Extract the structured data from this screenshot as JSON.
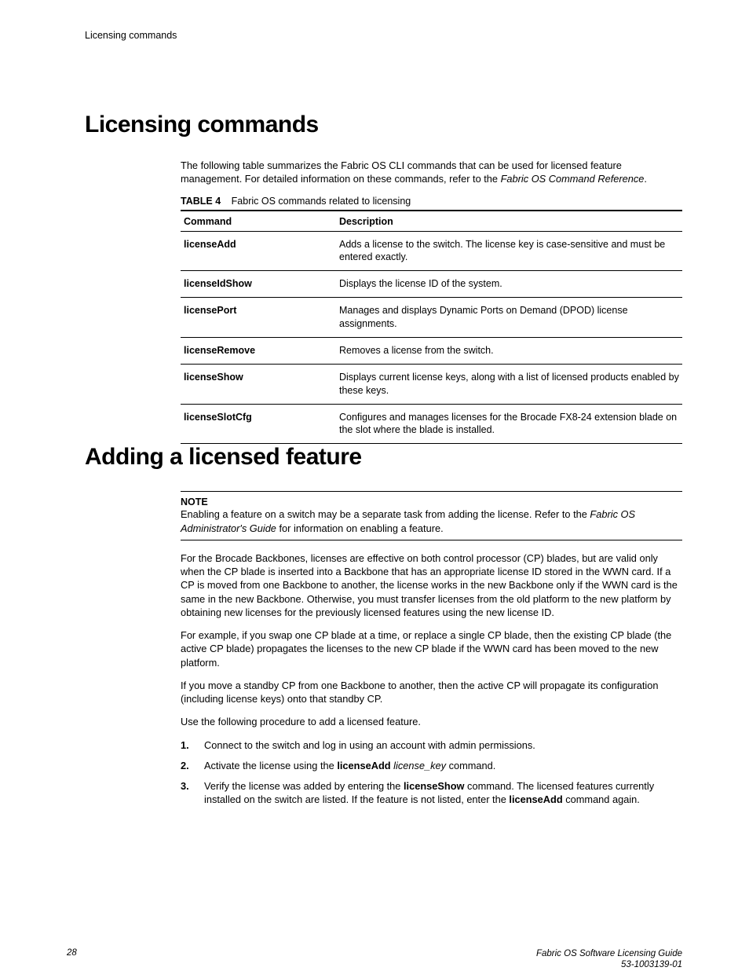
{
  "header": {
    "running": "Licensing commands"
  },
  "section1": {
    "title": "Licensing commands",
    "intro_a": "The following table summarizes the Fabric OS CLI commands that can be used for licensed feature management. For detailed information on these commands, refer to the ",
    "intro_ref": "Fabric OS Command Reference",
    "intro_b": ".",
    "table": {
      "label": "TABLE 4",
      "caption": "Fabric OS commands related to licensing",
      "col1": "Command",
      "col2": "Description",
      "rows": [
        {
          "cmd": "licenseAdd",
          "desc": "Adds a license to the switch. The license key is case-sensitive and must be entered exactly."
        },
        {
          "cmd": "licenseIdShow",
          "desc": "Displays the license ID of the system."
        },
        {
          "cmd": "licensePort",
          "desc": "Manages and displays Dynamic Ports on Demand (DPOD) license assignments."
        },
        {
          "cmd": "licenseRemove",
          "desc": "Removes a license from the switch."
        },
        {
          "cmd": "licenseShow",
          "desc": "Displays current license keys, along with a list of licensed products enabled by these keys."
        },
        {
          "cmd": "licenseSlotCfg",
          "desc": "Configures and manages licenses for the Brocade FX8-24 extension blade on the slot where the blade is installed."
        }
      ]
    }
  },
  "section2": {
    "title": "Adding a licensed feature",
    "note_label": "NOTE",
    "note_a": "Enabling a feature on a switch may be a separate task from adding the license. Refer to the ",
    "note_ref": "Fabric OS Administrator's Guide",
    "note_b": " for information on enabling a feature.",
    "para1": "For the Brocade Backbones, licenses are effective on both control processor (CP) blades, but are valid only when the CP blade is inserted into a Backbone that has an appropriate license ID stored in the WWN card. If a CP is moved from one Backbone to another, the license works in the new Backbone only if the WWN card is the same in the new Backbone. Otherwise, you must transfer licenses from the old platform to the new platform by obtaining new licenses for the previously licensed features using the new license ID.",
    "para2": "For example, if you swap one CP blade at a time, or replace a single CP blade, then the existing CP blade (the active CP blade) propagates the licenses to the new CP blade if the WWN card has been moved to the new platform.",
    "para3": "If you move a standby CP from one Backbone to another, then the active CP will propagate its configuration (including license keys) onto that standby CP.",
    "para4": "Use the following procedure to add a licensed feature.",
    "steps": {
      "s1": "Connect to the switch and log in using an account with admin permissions.",
      "s2a": "Activate the license using the ",
      "s2b": "licenseAdd",
      "s2c": " ",
      "s2d": "license_key",
      "s2e": " command.",
      "s3a": "Verify the license was added by entering the ",
      "s3b": "licenseShow",
      "s3c": " command. The licensed features currently installed on the switch are listed. If the feature is not listed, enter the ",
      "s3d": "licenseAdd",
      "s3e": " command again."
    }
  },
  "footer": {
    "page": "28",
    "title": "Fabric OS Software Licensing Guide",
    "docnum": "53-1003139-01"
  }
}
